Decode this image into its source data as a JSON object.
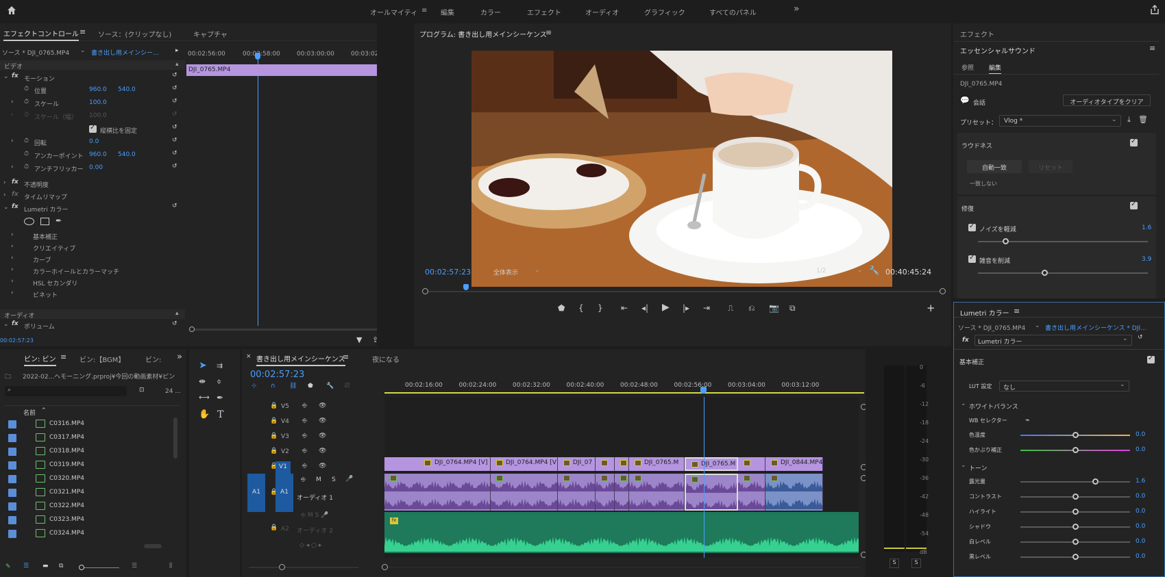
{
  "top": {
    "workspaces": [
      "オールマイティ",
      "編集",
      "カラー",
      "エフェクト",
      "オーディオ",
      "グラフィック",
      "すべてのパネル"
    ],
    "more": "»"
  },
  "effect_controls": {
    "tabs": [
      "エフェクトコントロール",
      "ソース：(クリップなし)",
      "キャプチャ"
    ],
    "source_label": "ソース * DJI_0765.MP4",
    "seq_label": "書き出し用メインシー...",
    "ruler": [
      "00:02:56:00",
      "00:02:58:00",
      "00:03:00:00",
      "00:03:02:00"
    ],
    "clip_name": "DJI_0765.MP4",
    "section_video": "ビデオ",
    "motion": "モーション",
    "rows": [
      {
        "label": "位置",
        "v1": "960.0",
        "v2": "540.0"
      },
      {
        "label": "スケール",
        "v1": "100.0",
        "v2": ""
      },
      {
        "label": "スケール（幅）",
        "v1": "100.0",
        "v2": ""
      },
      {
        "label": "縦横比を固定",
        "v1": "",
        "v2": ""
      },
      {
        "label": "回転",
        "v1": "0.0",
        "v2": ""
      },
      {
        "label": "アンカーポイント",
        "v1": "960.0",
        "v2": "540.0"
      },
      {
        "label": "アンチフリッカー",
        "v1": "0.00",
        "v2": ""
      }
    ],
    "opacity": "不透明度",
    "timeremap": "タイムリマップ",
    "lumetri": "Lumetri カラー",
    "lumetri_items": [
      "基本補正",
      "クリエイティブ",
      "カーブ",
      "カラーホイールとカラーマッチ",
      "HSL セカンダリ",
      "ビネット"
    ],
    "section_audio": "オーディオ",
    "volume": "ボリューム",
    "timecode": "00:02:57:23"
  },
  "program": {
    "title": "プログラム: 書き出し用メインシーケンス",
    "timecode": "00:02:57:23",
    "fit": "全体表示",
    "res": "1/2",
    "duration": "00:40:45:24"
  },
  "essential": {
    "panel": "エフェクト",
    "title": "エッセンシャルサウンド",
    "tabs": [
      "参照",
      "編集"
    ],
    "clip": "DJI_0765.MP4",
    "type": "会話",
    "clear": "オーディオタイプをクリア",
    "preset_label": "プリセット：",
    "preset": "Vlog *",
    "loudness": "ラウドネス",
    "auto": "自動一致",
    "reset": "リセット",
    "nomatch": "一致しない",
    "repair": "修復",
    "noise": "ノイズを軽減",
    "noise_val": "1.6",
    "hum": "雑音を削減",
    "hum_val": "3.9",
    "noise_level": 0.16,
    "hum_level": 0.39
  },
  "lumetri": {
    "title": "Lumetri カラー",
    "source": "ソース * DJI_0765.MP4",
    "seq": "書き出し用メインシーケンス * DJI...",
    "effect": "Lumetri カラー",
    "basic": "基本補正",
    "lut_label": "LUT 設定",
    "lut": "なし",
    "wb": "ホワイトバランス",
    "wb_sel": "WB セレクター",
    "sliders": [
      {
        "label": "色温度",
        "value": "0.0",
        "pos": 0.5
      },
      {
        "label": "色かぶり補正",
        "value": "0.0",
        "pos": 0.5
      }
    ],
    "tone": "トーン",
    "tone_sliders": [
      {
        "label": "露光量",
        "value": "1.6",
        "pos": 0.68
      },
      {
        "label": "コントラスト",
        "value": "0.0",
        "pos": 0.5
      },
      {
        "label": "ハイライト",
        "value": "0.0",
        "pos": 0.5
      },
      {
        "label": "シャドウ",
        "value": "0.0",
        "pos": 0.5
      },
      {
        "label": "白レベル",
        "value": "0.0",
        "pos": 0.5
      },
      {
        "label": "黒レベル",
        "value": "0.0",
        "pos": 0.5
      }
    ]
  },
  "project": {
    "tabs": [
      "ビン: ビン",
      "ビン:【BGM】",
      "ビン:"
    ],
    "path": "2022-02...ヘモーニング.prproj¥今回の動画素材¥ピン",
    "count": "24 ...",
    "col_name": "名前",
    "files": [
      "C0316.MP4",
      "C0317.MP4",
      "C0318.MP4",
      "C0319.MP4",
      "C0320.MP4",
      "C0321.MP4",
      "C0322.MP4",
      "C0323.MP4",
      "C0324.MP4"
    ]
  },
  "timeline": {
    "tabs": [
      "書き出し用メインシーケンス",
      "夜になる"
    ],
    "timecode": "00:02:57:23",
    "ruler": [
      "00:02:16:00",
      "00:02:24:00",
      "00:02:32:00",
      "00:02:40:00",
      "00:02:48:00",
      "00:02:56:00",
      "00:03:04:00",
      "00:03:12:00"
    ],
    "vtracks": [
      "V5",
      "V4",
      "V3",
      "V2",
      "V1"
    ],
    "atracks": [
      "A1",
      "A2"
    ],
    "audio1": "オーディオ 1",
    "audio2": "オーディオ 2",
    "clips": [
      "DJI_0764.MP4 [V]",
      "DJI_0764.MP4 [V]",
      "DJI_07",
      "",
      "",
      "DJI_0765.M",
      "DJI_0765.M",
      "",
      "DJI_0844.MP4"
    ]
  },
  "meter": {
    "scale": [
      "0",
      "-6",
      "-12",
      "-18",
      "-24",
      "-30",
      "-36",
      "-42",
      "-48",
      "-54",
      "dB"
    ],
    "solo": [
      "S",
      "S"
    ]
  }
}
